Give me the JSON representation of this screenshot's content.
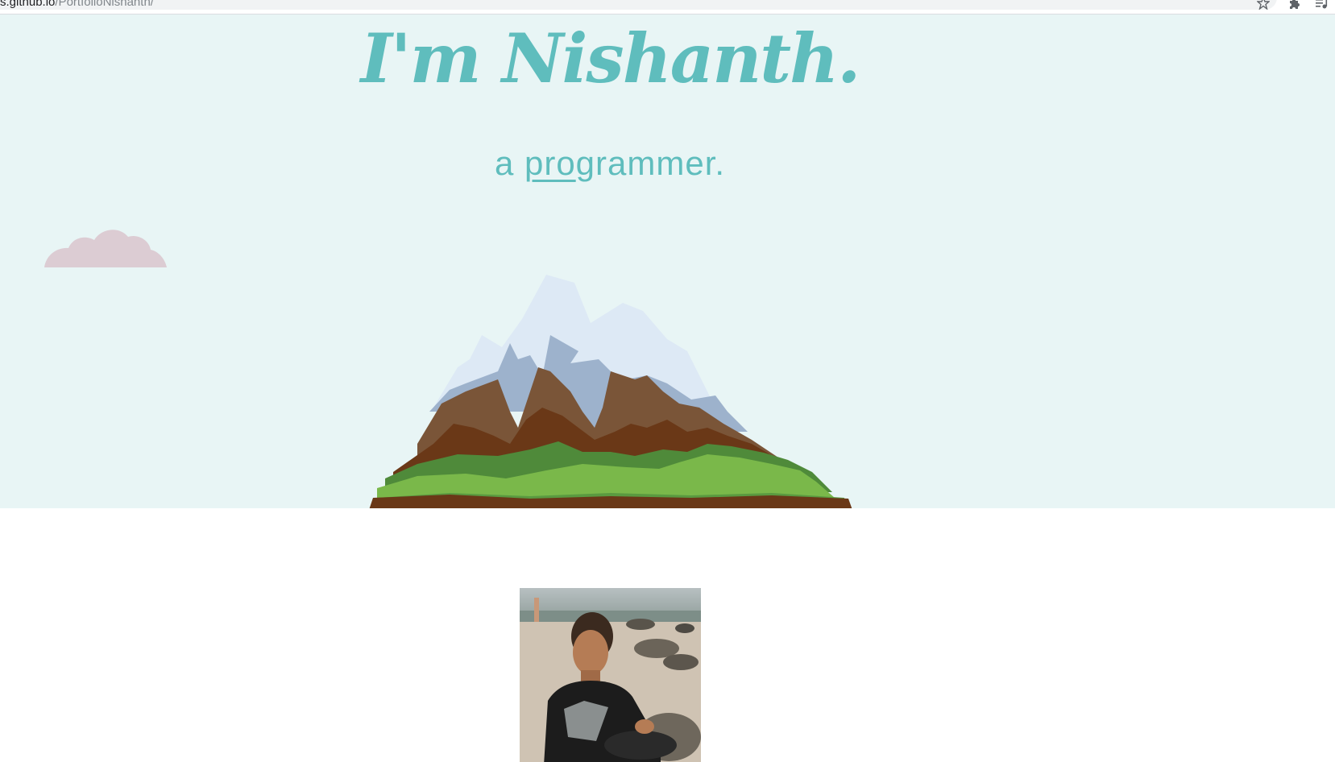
{
  "browser": {
    "url_host": "s.github.io",
    "url_path": "/PortfolioNishanth/",
    "bookmark_icon": "star-icon",
    "extensions_icon": "puzzle-icon",
    "media_icon": "media-control-icon"
  },
  "hero": {
    "title": "I'm Nishanth.",
    "subtitle_prefix": "a ",
    "subtitle_typed": "pro",
    "subtitle_rest": "grammer.",
    "background_color": "#e8f5f5",
    "accent_color": "#5fbdbd"
  },
  "about": {
    "photo_alt": "Nishanth sitting on a rocky beach"
  },
  "colors": {
    "cloud": "#dcccd3",
    "snow": "#dde9f5",
    "snow_shadow": "#9db2cc",
    "rock_light": "#7a5538",
    "rock_dark": "#6a3817",
    "grass_dark": "#4f8a3a",
    "grass_light": "#7ab84a"
  }
}
